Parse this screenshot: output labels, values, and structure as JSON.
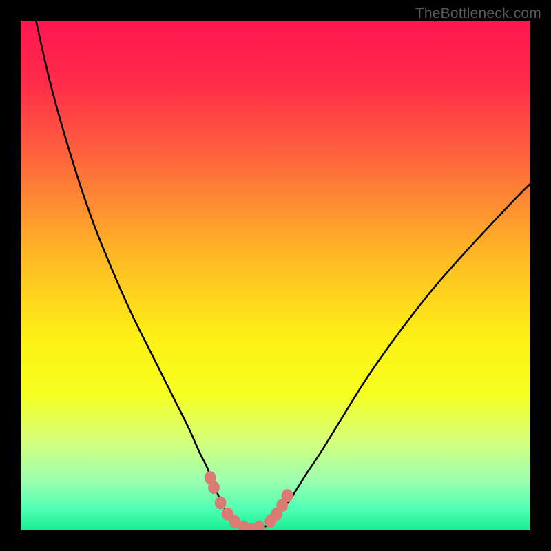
{
  "watermark": {
    "text": "TheBottleneck.com"
  },
  "colors": {
    "black": "#000000",
    "curve": "#000000",
    "marker_fill": "#da7c74",
    "marker_stroke": "#b85a54",
    "grad_stops": [
      {
        "offset": 0.0,
        "color": "#ff1750"
      },
      {
        "offset": 0.12,
        "color": "#ff2b4a"
      },
      {
        "offset": 0.28,
        "color": "#fe6a3b"
      },
      {
        "offset": 0.45,
        "color": "#feb427"
      },
      {
        "offset": 0.62,
        "color": "#fdf015"
      },
      {
        "offset": 0.73,
        "color": "#f6ff1f"
      },
      {
        "offset": 0.82,
        "color": "#d7ff77"
      },
      {
        "offset": 0.9,
        "color": "#9fffb0"
      },
      {
        "offset": 0.96,
        "color": "#4dffb4"
      },
      {
        "offset": 1.0,
        "color": "#18ec93"
      }
    ]
  },
  "chart_data": {
    "type": "line",
    "title": "",
    "xlabel": "",
    "ylabel": "",
    "x_range": [
      0,
      100
    ],
    "y_range": [
      0,
      100
    ],
    "series": [
      {
        "name": "left-branch",
        "x": [
          3,
          6,
          10,
          14,
          18,
          22,
          26,
          30,
          33,
          35,
          36.5,
          37.5,
          38.5,
          39.5,
          40.5,
          41.5,
          43,
          46
        ],
        "y": [
          100,
          87,
          73,
          61,
          51,
          42,
          34,
          26,
          20,
          15.5,
          12.5,
          10,
          7.5,
          5.3,
          3.4,
          2.0,
          0.8,
          0
        ]
      },
      {
        "name": "right-branch",
        "x": [
          46,
          48,
          49.5,
          51,
          52.5,
          54,
          56,
          59,
          63,
          68,
          74,
          81,
          89,
          97,
          100
        ],
        "y": [
          0,
          0.8,
          2.0,
          3.6,
          5.5,
          7.8,
          11,
          15.5,
          22,
          30,
          38.5,
          47.5,
          56.5,
          65,
          68
        ]
      }
    ],
    "markers": {
      "name": "highlight-dots",
      "x": [
        37.2,
        37.9,
        39.2,
        40.6,
        42.0,
        43.7,
        45.3,
        46.8,
        49.0,
        50.2,
        51.3,
        52.3
      ],
      "y": [
        10.3,
        8.4,
        5.4,
        3.2,
        1.7,
        0.6,
        0.2,
        0.6,
        1.8,
        3.2,
        4.9,
        6.8
      ]
    }
  }
}
